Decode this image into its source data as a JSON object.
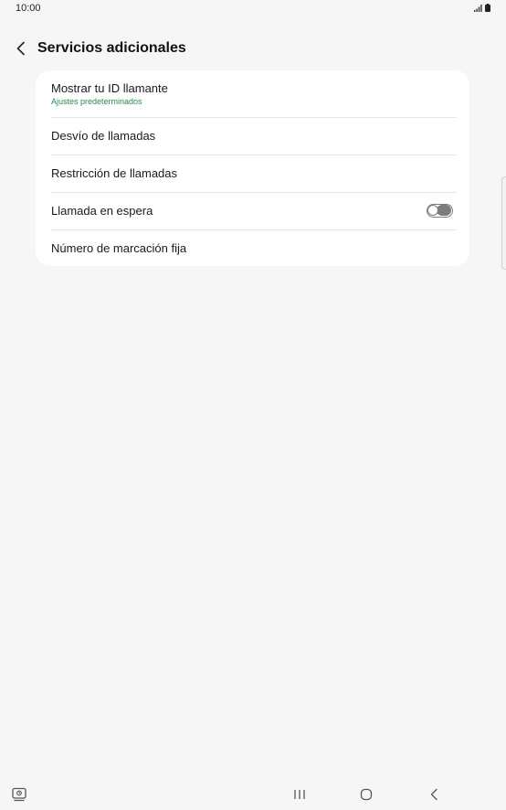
{
  "status_bar": {
    "time": "10:00",
    "icons": [
      "signal-icon",
      "battery-icon"
    ]
  },
  "header": {
    "title": "Servicios adicionales",
    "back_icon": "chevron-left-icon"
  },
  "settings": {
    "items": [
      {
        "title": "Mostrar tu ID llamante",
        "subtitle": "Ajustes predeterminados"
      },
      {
        "title": "Desvío de llamadas"
      },
      {
        "title": "Restricción de llamadas"
      },
      {
        "title": "Llamada en espera",
        "toggle_on": false
      },
      {
        "title": "Número de marcación fija"
      }
    ]
  },
  "nav_bar": {
    "buttons": [
      "screen-assist-icon",
      "recent-apps-icon",
      "home-icon",
      "back-icon"
    ]
  },
  "colors": {
    "background": "#f6f6f6",
    "card": "#ffffff",
    "subtitle_accent": "#2a8a4a",
    "toggle_off": "#7c7c7c"
  }
}
